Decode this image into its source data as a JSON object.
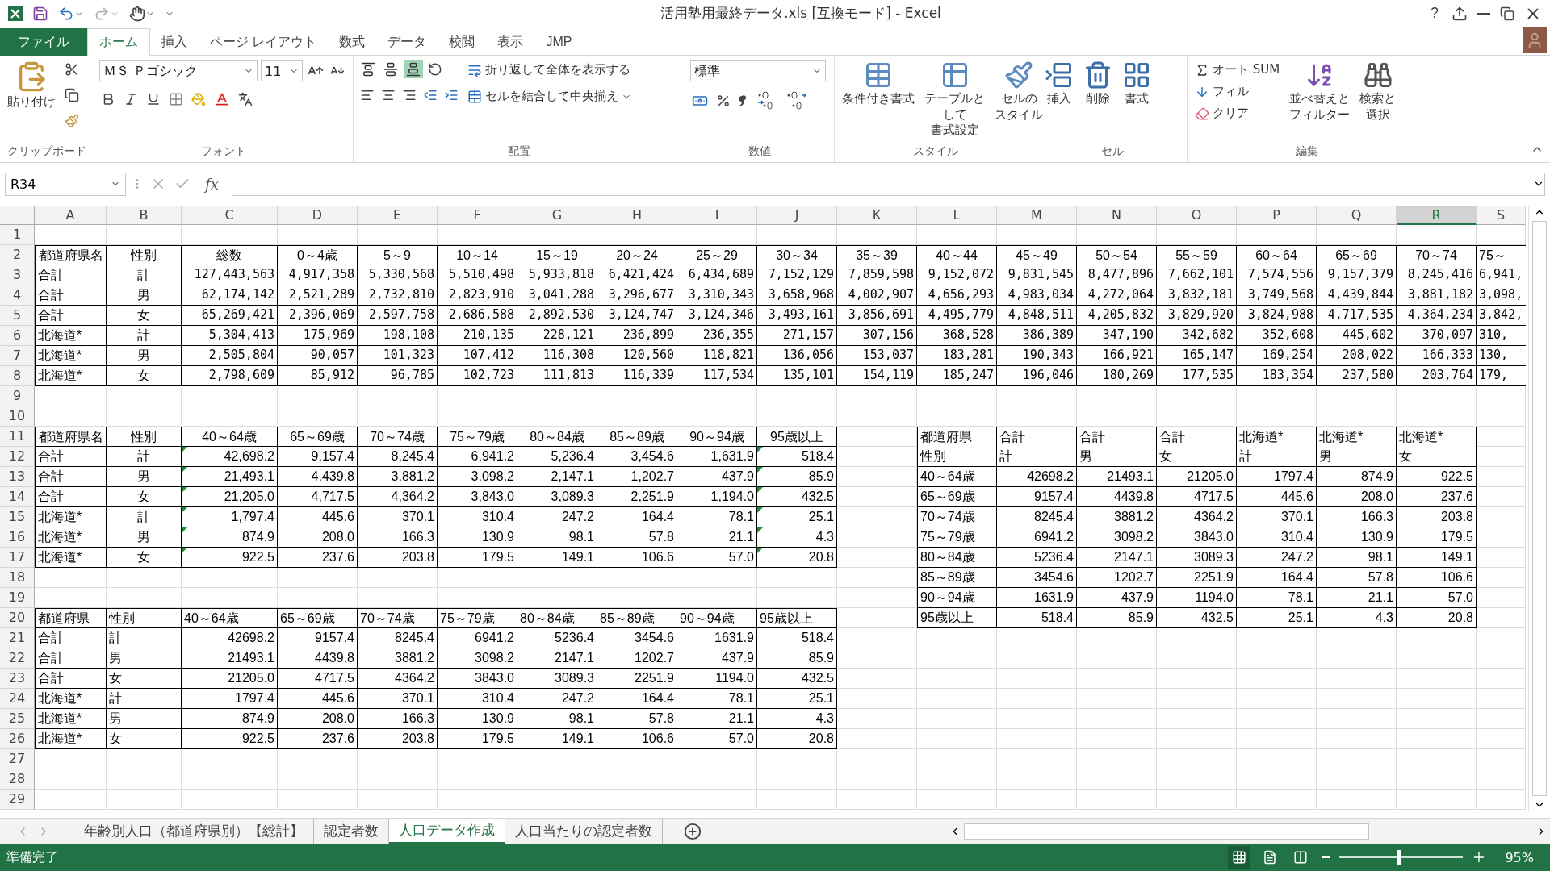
{
  "window": {
    "title": "活用塾用最終データ.xls  [互換モード] - Excel",
    "help": "?"
  },
  "ribbon_tabs": [
    {
      "label": "ファイル",
      "kind": "file",
      "selected": false
    },
    {
      "label": "ホーム",
      "kind": "tab",
      "selected": true
    },
    {
      "label": "挿入",
      "kind": "tab",
      "selected": false
    },
    {
      "label": "ページ レイアウト",
      "kind": "tab",
      "selected": false
    },
    {
      "label": "数式",
      "kind": "tab",
      "selected": false
    },
    {
      "label": "データ",
      "kind": "tab",
      "selected": false
    },
    {
      "label": "校閲",
      "kind": "tab",
      "selected": false
    },
    {
      "label": "表示",
      "kind": "tab",
      "selected": false
    },
    {
      "label": "JMP",
      "kind": "tab",
      "selected": false
    }
  ],
  "ribbon": {
    "clipboard": {
      "label": "クリップボード",
      "paste": "貼り付け"
    },
    "font": {
      "label": "フォント",
      "font_name": "ＭＳ Ｐゴシック",
      "font_size": "11"
    },
    "alignment": {
      "label": "配置",
      "vertical_align": [
        {
          "selected": false
        },
        {
          "selected": false
        },
        {
          "selected": true
        }
      ],
      "wrap_text": "折り返して全体を表示する",
      "merge": "セルを結合して中央揃え"
    },
    "number": {
      "label": "数値",
      "format": "標準"
    },
    "styles": {
      "label": "スタイル",
      "buttons": [
        "条件付き書式",
        "テーブルとして書式設定",
        "セルのスタイル"
      ]
    },
    "cells": {
      "label": "セル",
      "buttons": [
        "挿入",
        "削除",
        "書式"
      ]
    },
    "editing": {
      "label": "編集",
      "autosum": "オート SUM",
      "fill": "フィル",
      "clear": "クリア",
      "sort": "並べ替えとフィルター",
      "find": "検索と選択"
    }
  },
  "formula_bar": {
    "name_box": "R34",
    "function_label": "fx"
  },
  "sheet": {
    "columns": [
      {
        "label": "A",
        "selected": false
      },
      {
        "label": "B",
        "selected": false
      },
      {
        "label": "C",
        "selected": false
      },
      {
        "label": "D",
        "selected": false
      },
      {
        "label": "E",
        "selected": false
      },
      {
        "label": "F",
        "selected": false
      },
      {
        "label": "G",
        "selected": false
      },
      {
        "label": "H",
        "selected": false
      },
      {
        "label": "I",
        "selected": false
      },
      {
        "label": "J",
        "selected": false
      },
      {
        "label": "K",
        "selected": false
      },
      {
        "label": "L",
        "selected": false
      },
      {
        "label": "M",
        "selected": false
      },
      {
        "label": "N",
        "selected": false
      },
      {
        "label": "O",
        "selected": false
      },
      {
        "label": "P",
        "selected": false
      },
      {
        "label": "Q",
        "selected": false
      },
      {
        "label": "R",
        "selected": true
      },
      {
        "label": "S",
        "selected": false
      }
    ],
    "row_numbers": [
      "1",
      "2",
      "3",
      "4",
      "5",
      "6",
      "7",
      "8",
      "9",
      "10",
      "11",
      "12",
      "13",
      "14",
      "15",
      "16",
      "17",
      "18",
      "19",
      "20",
      "21",
      "22",
      "23",
      "24",
      "25",
      "26",
      "27",
      "28",
      "29"
    ],
    "tables": [
      {
        "header_rows": [
          [
            "都道府県名",
            "性別",
            "総数",
            "0～4歳",
            "5～9",
            "10～14",
            "15～19",
            "20～24",
            "25～29",
            "30～34",
            "35～39",
            "40～44",
            "45～49",
            "50～54",
            "55～59",
            "60～64",
            "65～69",
            "70～74",
            "75～"
          ]
        ],
        "rows": [
          {
            "cells": [
              "合計",
              "計",
              "127,443,563",
              "4,917,358",
              "5,330,568",
              "5,510,498",
              "5,933,818",
              "6,421,424",
              "6,434,689",
              "7,152,129",
              "7,859,598",
              "9,152,072",
              "9,831,545",
              "8,477,896",
              "7,662,101",
              "7,574,556",
              "9,157,379",
              "8,245,416",
              "6,941,"
            ]
          },
          {
            "cells": [
              "合計",
              "男",
              "62,174,142",
              "2,521,289",
              "2,732,810",
              "2,823,910",
              "3,041,288",
              "3,296,677",
              "3,310,343",
              "3,658,968",
              "4,002,907",
              "4,656,293",
              "4,983,034",
              "4,272,064",
              "3,832,181",
              "3,749,568",
              "4,439,844",
              "3,881,182",
              "3,098,"
            ]
          },
          {
            "cells": [
              "合計",
              "女",
              "65,269,421",
              "2,396,069",
              "2,597,758",
              "2,686,588",
              "2,892,530",
              "3,124,747",
              "3,124,346",
              "3,493,161",
              "3,856,691",
              "4,495,779",
              "4,848,511",
              "4,205,832",
              "3,829,920",
              "3,824,988",
              "4,717,535",
              "4,364,234",
              "3,842,"
            ]
          },
          {
            "cells": [
              "北海道*",
              "計",
              "5,304,413",
              "175,969",
              "198,108",
              "210,135",
              "228,121",
              "236,899",
              "236,355",
              "271,157",
              "307,156",
              "368,528",
              "386,389",
              "347,190",
              "342,682",
              "352,608",
              "445,602",
              "370,097",
              "310,"
            ]
          },
          {
            "cells": [
              "北海道*",
              "男",
              "2,505,804",
              "90,057",
              "101,323",
              "107,412",
              "116,308",
              "120,560",
              "118,821",
              "136,056",
              "153,037",
              "183,281",
              "190,343",
              "166,921",
              "165,147",
              "169,254",
              "208,022",
              "166,333",
              "130,"
            ]
          },
          {
            "cells": [
              "北海道*",
              "女",
              "2,798,609",
              "85,912",
              "96,785",
              "102,723",
              "111,813",
              "116,339",
              "117,534",
              "135,101",
              "154,119",
              "185,247",
              "196,046",
              "180,269",
              "177,535",
              "183,354",
              "237,580",
              "203,764",
              "179,"
            ]
          }
        ]
      },
      {
        "header_rows": [
          [
            "都道府県名",
            "性別",
            "40～64歳",
            "65～69歳",
            "70～74歳",
            "75～79歳",
            "80～84歳",
            "85～89歳",
            "90～94歳",
            "95歳以上"
          ]
        ],
        "rows": [
          {
            "flagged": true,
            "cells": [
              "合計",
              "計",
              "42,698.2",
              "9,157.4",
              "8,245.4",
              "6,941.2",
              "5,236.4",
              "3,454.6",
              "1,631.9",
              "518.4"
            ]
          },
          {
            "flagged": true,
            "cells": [
              "合計",
              "男",
              "21,493.1",
              "4,439.8",
              "3,881.2",
              "3,098.2",
              "2,147.1",
              "1,202.7",
              "437.9",
              "85.9"
            ]
          },
          {
            "flagged": true,
            "cells": [
              "合計",
              "女",
              "21,205.0",
              "4,717.5",
              "4,364.2",
              "3,843.0",
              "3,089.3",
              "2,251.9",
              "1,194.0",
              "432.5"
            ]
          },
          {
            "flagged": true,
            "cells": [
              "北海道*",
              "計",
              "1,797.4",
              "445.6",
              "370.1",
              "310.4",
              "247.2",
              "164.4",
              "78.1",
              "25.1"
            ]
          },
          {
            "flagged": true,
            "cells": [
              "北海道*",
              "男",
              "874.9",
              "208.0",
              "166.3",
              "130.9",
              "98.1",
              "57.8",
              "21.1",
              "4.3"
            ]
          },
          {
            "flagged": true,
            "cells": [
              "北海道*",
              "女",
              "922.5",
              "237.6",
              "203.8",
              "179.5",
              "149.1",
              "106.6",
              "57.0",
              "20.8"
            ]
          }
        ]
      },
      {
        "header_rows": [
          [
            "都道府県",
            "性別",
            "40～64歳",
            "65～69歳",
            "70～74歳",
            "75～79歳",
            "80～84歳",
            "85～89歳",
            "90～94歳",
            "95歳以上"
          ]
        ],
        "rows": [
          {
            "cells": [
              "合計",
              "計",
              "42698.2",
              "9157.4",
              "8245.4",
              "6941.2",
              "5236.4",
              "3454.6",
              "1631.9",
              "518.4"
            ]
          },
          {
            "cells": [
              "合計",
              "男",
              "21493.1",
              "4439.8",
              "3881.2",
              "3098.2",
              "2147.1",
              "1202.7",
              "437.9",
              "85.9"
            ]
          },
          {
            "cells": [
              "合計",
              "女",
              "21205.0",
              "4717.5",
              "4364.2",
              "3843.0",
              "3089.3",
              "2251.9",
              "1194.0",
              "432.5"
            ]
          },
          {
            "cells": [
              "北海道*",
              "計",
              "1797.4",
              "445.6",
              "370.1",
              "310.4",
              "247.2",
              "164.4",
              "78.1",
              "25.1"
            ]
          },
          {
            "cells": [
              "北海道*",
              "男",
              "874.9",
              "208.0",
              "166.3",
              "130.9",
              "98.1",
              "57.8",
              "21.1",
              "4.3"
            ]
          },
          {
            "cells": [
              "北海道*",
              "女",
              "922.5",
              "237.6",
              "203.8",
              "179.5",
              "149.1",
              "106.6",
              "57.0",
              "20.8"
            ]
          }
        ]
      },
      {
        "header_rows": [
          [
            "都道府県",
            "合計",
            "合計",
            "合計",
            "北海道*",
            "北海道*",
            "北海道*"
          ],
          [
            "性別",
            "計",
            "男",
            "女",
            "計",
            "男",
            "女"
          ]
        ],
        "rows": [
          {
            "cells": [
              "40～64歳",
              "42698.2",
              "21493.1",
              "21205.0",
              "1797.4",
              "874.9",
              "922.5"
            ]
          },
          {
            "cells": [
              "65～69歳",
              "9157.4",
              "4439.8",
              "4717.5",
              "445.6",
              "208.0",
              "237.6"
            ]
          },
          {
            "cells": [
              "70～74歳",
              "8245.4",
              "3881.2",
              "4364.2",
              "370.1",
              "166.3",
              "203.8"
            ]
          },
          {
            "cells": [
              "75～79歳",
              "6941.2",
              "3098.2",
              "3843.0",
              "310.4",
              "130.9",
              "179.5"
            ]
          },
          {
            "cells": [
              "80～84歳",
              "5236.4",
              "2147.1",
              "3089.3",
              "247.2",
              "98.1",
              "149.1"
            ]
          },
          {
            "cells": [
              "85～89歳",
              "3454.6",
              "1202.7",
              "2251.9",
              "164.4",
              "57.8",
              "106.6"
            ]
          },
          {
            "cells": [
              "90～94歳",
              "1631.9",
              "437.9",
              "1194.0",
              "78.1",
              "21.1",
              "57.0"
            ]
          },
          {
            "cells": [
              "95歳以上",
              "518.4",
              "85.9",
              "432.5",
              "25.1",
              "4.3",
              "20.8"
            ]
          }
        ]
      }
    ]
  },
  "sheet_tabs": [
    {
      "label": "年齢別人口（都道府県別）【総計】",
      "selected": false
    },
    {
      "label": "認定者数",
      "selected": false
    },
    {
      "label": "人口データ作成",
      "selected": true
    },
    {
      "label": "人口当たりの認定者数",
      "selected": false
    }
  ],
  "status_bar": {
    "status": "準備完了",
    "zoom": "95%",
    "zoom_slider": {
      "level": 0.48
    }
  }
}
